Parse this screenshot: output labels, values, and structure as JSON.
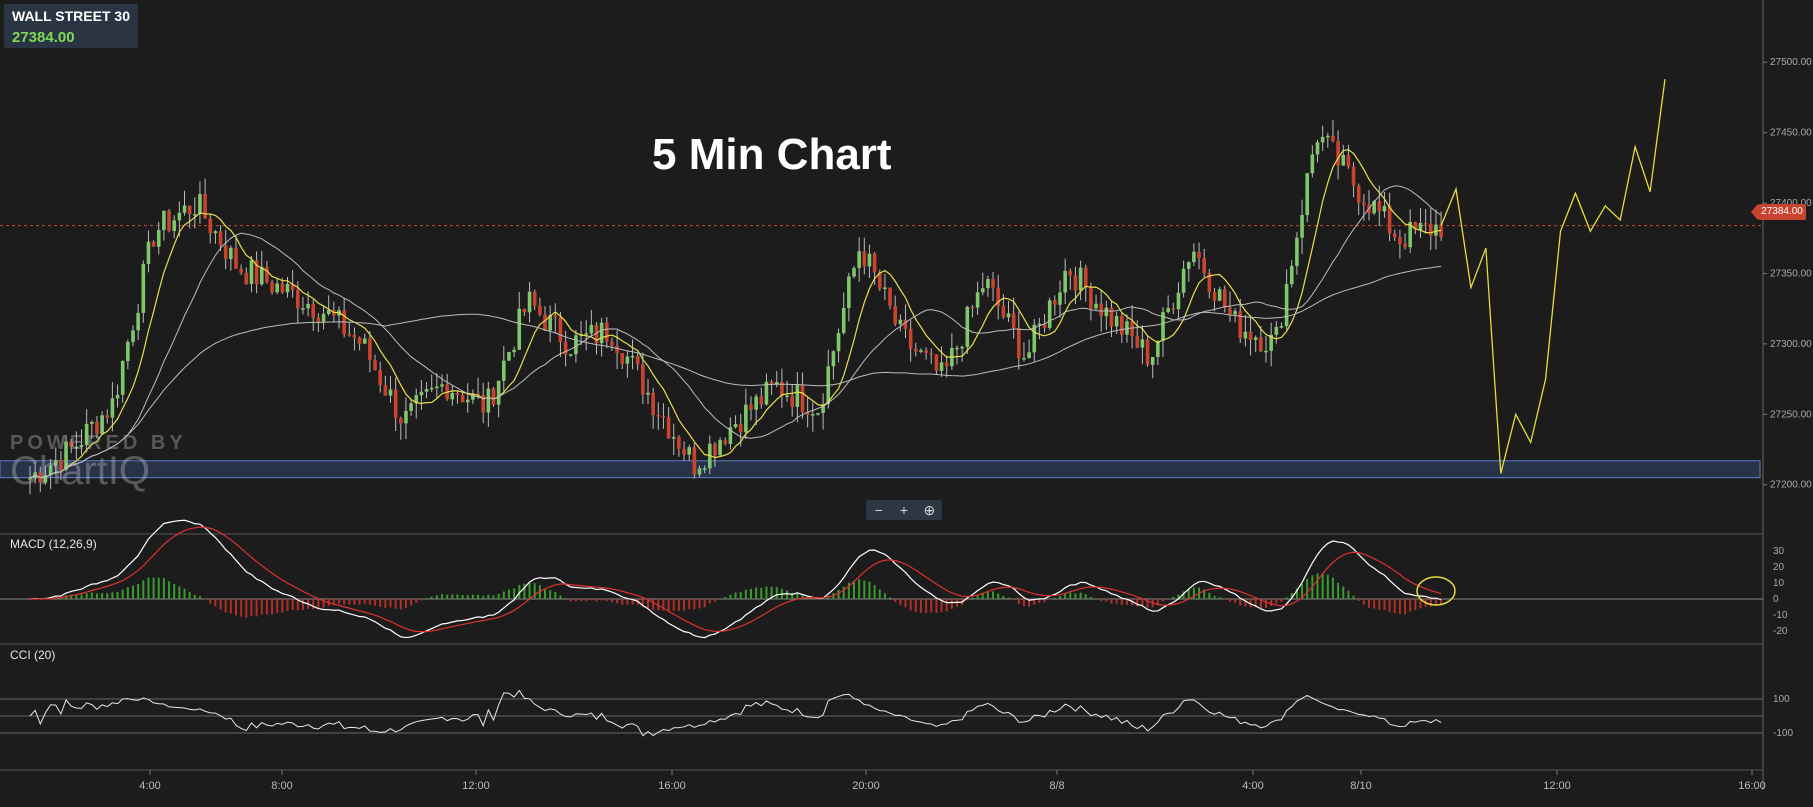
{
  "ticker": {
    "symbol": "WALL STREET 30",
    "price": "27384.00"
  },
  "title": "5 Min Chart",
  "price_label": "27384.00",
  "watermark": {
    "line1": "POWERED BY",
    "line2": "ChartIQ"
  },
  "zoom": {
    "minus": "−",
    "plus": "+",
    "reset": "⊕"
  },
  "macd_label": "MACD (12,26,9)",
  "cci_label": "CCI (20)",
  "colors": {
    "bg": "#1c1c1c",
    "up": "#7ec86b",
    "down": "#c9432e",
    "ma_fast": "#e8e04a",
    "ma_slow": "#bcbcbc",
    "support": "#3f5fa0",
    "macd_line": "#ffffff",
    "signal_line": "#e03030"
  },
  "chart_data": {
    "type": "candlestick",
    "x_ticks": [
      "4:00",
      "8:00",
      "12:00",
      "16:00",
      "20:00",
      "8/8",
      "4:00",
      "8/10",
      "12:00",
      "16:00"
    ],
    "y_ticks": [
      "27500.00",
      "27450.00",
      "27400.00",
      "27350.00",
      "27300.00",
      "27250.00",
      "27200.00"
    ],
    "ylim": [
      27165,
      27530
    ],
    "last_price": 27384,
    "support_zone": [
      27205,
      27217
    ],
    "price_path": [
      27205,
      27225,
      27258,
      27380,
      27400,
      27355,
      27340,
      27325,
      27300,
      27245,
      27272,
      27255,
      27330,
      27300,
      27310,
      27260,
      27215,
      27245,
      27270,
      27255,
      27370,
      27305,
      27275,
      27345,
      27290,
      27355,
      27320,
      27290,
      27370,
      27315,
      27300,
      27450,
      27410,
      27375,
      27384
    ],
    "projection": [
      27384,
      27410,
      27340,
      27368,
      27208,
      27250,
      27230,
      27275,
      27380,
      27407,
      27380,
      27398,
      27388,
      27440,
      27408,
      27488
    ],
    "macd": {
      "ylim": [
        -25,
        35
      ],
      "y_ticks": [
        "30",
        "20",
        "10",
        "0",
        "-10",
        "-20"
      ],
      "params": "12,26,9"
    },
    "cci": {
      "y_ticks": [
        "100",
        "-100"
      ],
      "period": 20
    }
  }
}
